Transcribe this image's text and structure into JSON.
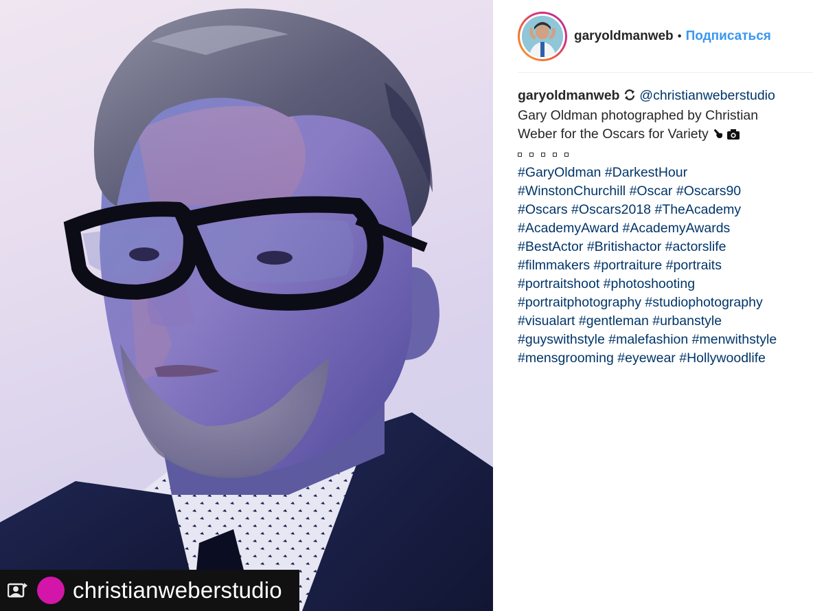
{
  "photo": {
    "repost_user": "christianweberstudio"
  },
  "header": {
    "username": "garyoldmanweb",
    "separator": "•",
    "follow_label": "Подписаться"
  },
  "caption": {
    "username": "garyoldmanweb",
    "mention": "@christianweberstudio",
    "text_line1": "Gary Oldman photographed by Christian",
    "text_line2": "Weber for the Oscars for Variety",
    "hashtag_lines": [
      [
        "#GaryOldman",
        "#DarkestHour"
      ],
      [
        "#WinstonChurchill",
        "#Oscar",
        "#Oscars90"
      ],
      [
        "#Oscars",
        "#Oscars2018",
        "#TheAcademy"
      ],
      [
        "#AcademyAward",
        "#AcademyAwards"
      ],
      [
        "#BestActor",
        "#Britishactor",
        "#actorslife"
      ],
      [
        "#filmmakers",
        "#portraiture",
        "#portraits"
      ],
      [
        "#portraitshoot",
        "#photoshooting"
      ],
      [
        "#portraitphotography",
        "#studiophotography"
      ],
      [
        "#visualart",
        "#gentleman",
        "#urbanstyle"
      ],
      [
        "#guyswithstyle",
        "#malefashion",
        "#menwithstyle"
      ],
      [
        "#mensgrooming",
        "#eyewear",
        "#Hollywoodlife"
      ]
    ]
  },
  "icons": {
    "repost": "repost-icon",
    "regram": "refresh-icon",
    "pointing_hand": "pointing-hand-icon",
    "camera": "camera-icon"
  },
  "colors": {
    "link": "#003569",
    "follow": "#3897f0",
    "repost_avatar": "#d316a9",
    "text": "#262626"
  }
}
